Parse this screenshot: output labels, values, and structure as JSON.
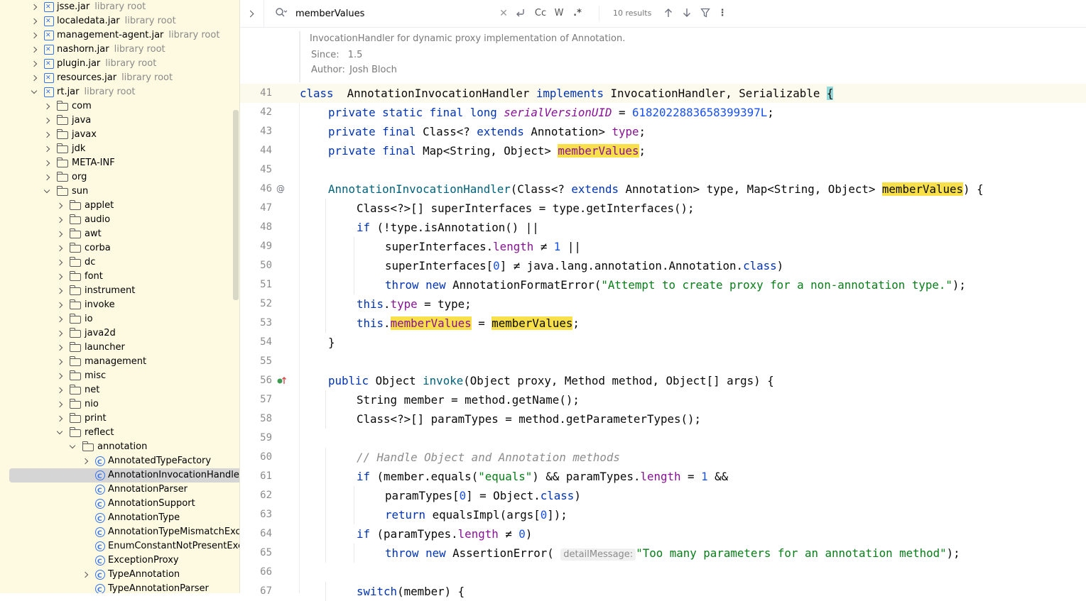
{
  "tree": {
    "rows": [
      {
        "indent": 0,
        "chev": "closed",
        "icon": "jar",
        "label": "jsse.jar",
        "sub": "library root"
      },
      {
        "indent": 0,
        "chev": "closed",
        "icon": "jar",
        "label": "localedata.jar",
        "sub": "library root"
      },
      {
        "indent": 0,
        "chev": "closed",
        "icon": "jar",
        "label": "management-agent.jar",
        "sub": "library root"
      },
      {
        "indent": 0,
        "chev": "closed",
        "icon": "jar",
        "label": "nashorn.jar",
        "sub": "library root"
      },
      {
        "indent": 0,
        "chev": "closed",
        "icon": "jar",
        "label": "plugin.jar",
        "sub": "library root"
      },
      {
        "indent": 0,
        "chev": "closed",
        "icon": "jar",
        "label": "resources.jar",
        "sub": "library root"
      },
      {
        "indent": 0,
        "chev": "open",
        "icon": "jar",
        "label": "rt.jar",
        "sub": "library root"
      },
      {
        "indent": 1,
        "chev": "closed",
        "icon": "folder",
        "label": "com",
        "sub": ""
      },
      {
        "indent": 1,
        "chev": "closed",
        "icon": "folder",
        "label": "java",
        "sub": ""
      },
      {
        "indent": 1,
        "chev": "closed",
        "icon": "folder",
        "label": "javax",
        "sub": ""
      },
      {
        "indent": 1,
        "chev": "closed",
        "icon": "folder",
        "label": "jdk",
        "sub": ""
      },
      {
        "indent": 1,
        "chev": "closed",
        "icon": "folder",
        "label": "META-INF",
        "sub": ""
      },
      {
        "indent": 1,
        "chev": "closed",
        "icon": "folder",
        "label": "org",
        "sub": ""
      },
      {
        "indent": 1,
        "chev": "open",
        "icon": "folder",
        "label": "sun",
        "sub": ""
      },
      {
        "indent": 2,
        "chev": "closed",
        "icon": "folder",
        "label": "applet",
        "sub": ""
      },
      {
        "indent": 2,
        "chev": "closed",
        "icon": "folder",
        "label": "audio",
        "sub": ""
      },
      {
        "indent": 2,
        "chev": "closed",
        "icon": "folder",
        "label": "awt",
        "sub": ""
      },
      {
        "indent": 2,
        "chev": "closed",
        "icon": "folder",
        "label": "corba",
        "sub": ""
      },
      {
        "indent": 2,
        "chev": "closed",
        "icon": "folder",
        "label": "dc",
        "sub": ""
      },
      {
        "indent": 2,
        "chev": "closed",
        "icon": "folder",
        "label": "font",
        "sub": ""
      },
      {
        "indent": 2,
        "chev": "closed",
        "icon": "folder",
        "label": "instrument",
        "sub": ""
      },
      {
        "indent": 2,
        "chev": "closed",
        "icon": "folder",
        "label": "invoke",
        "sub": ""
      },
      {
        "indent": 2,
        "chev": "closed",
        "icon": "folder",
        "label": "io",
        "sub": ""
      },
      {
        "indent": 2,
        "chev": "closed",
        "icon": "folder",
        "label": "java2d",
        "sub": ""
      },
      {
        "indent": 2,
        "chev": "closed",
        "icon": "folder",
        "label": "launcher",
        "sub": ""
      },
      {
        "indent": 2,
        "chev": "closed",
        "icon": "folder",
        "label": "management",
        "sub": ""
      },
      {
        "indent": 2,
        "chev": "closed",
        "icon": "folder",
        "label": "misc",
        "sub": ""
      },
      {
        "indent": 2,
        "chev": "closed",
        "icon": "folder",
        "label": "net",
        "sub": ""
      },
      {
        "indent": 2,
        "chev": "closed",
        "icon": "folder",
        "label": "nio",
        "sub": ""
      },
      {
        "indent": 2,
        "chev": "closed",
        "icon": "folder",
        "label": "print",
        "sub": ""
      },
      {
        "indent": 2,
        "chev": "open",
        "icon": "folder",
        "label": "reflect",
        "sub": ""
      },
      {
        "indent": 3,
        "chev": "open",
        "icon": "folder",
        "label": "annotation",
        "sub": ""
      },
      {
        "indent": 4,
        "chev": "closed",
        "icon": "cls",
        "label": "AnnotatedTypeFactory",
        "sub": ""
      },
      {
        "indent": 4,
        "chev": "none",
        "icon": "cls",
        "label": "AnnotationInvocationHandler",
        "sub": "",
        "selected": true
      },
      {
        "indent": 4,
        "chev": "none",
        "icon": "cls",
        "label": "AnnotationParser",
        "sub": ""
      },
      {
        "indent": 4,
        "chev": "none",
        "icon": "cls",
        "label": "AnnotationSupport",
        "sub": ""
      },
      {
        "indent": 4,
        "chev": "none",
        "icon": "cls",
        "label": "AnnotationType",
        "sub": ""
      },
      {
        "indent": 4,
        "chev": "none",
        "icon": "cls",
        "label": "AnnotationTypeMismatchExce",
        "sub": ""
      },
      {
        "indent": 4,
        "chev": "none",
        "icon": "cls",
        "label": "EnumConstantNotPresentExc",
        "sub": ""
      },
      {
        "indent": 4,
        "chev": "none",
        "icon": "cls",
        "label": "ExceptionProxy",
        "sub": ""
      },
      {
        "indent": 4,
        "chev": "closed",
        "icon": "cls",
        "label": "TypeAnnotation",
        "sub": ""
      },
      {
        "indent": 4,
        "chev": "none",
        "icon": "cls",
        "label": "TypeAnnotationParser",
        "sub": ""
      }
    ]
  },
  "find": {
    "value": "memberValues",
    "results": "10 results",
    "match_case": "Cc",
    "words": "W",
    "regex": ".*"
  },
  "doc": {
    "description": "InvocationHandler for dynamic proxy implementation of Annotation.",
    "since_label": "Since:",
    "since_value": "1.5",
    "author_label": "Author:",
    "author_value": "Josh Bloch"
  },
  "code": {
    "lines": [
      {
        "n": "41",
        "cur": true,
        "ind": 0,
        "segs": [
          [
            "kw",
            "class"
          ],
          [
            "",
            "  AnnotationInvocationHandler "
          ],
          [
            "kw",
            "implements"
          ],
          [
            "",
            " InvocationHandler, Serializable "
          ],
          [
            "brace",
            "{"
          ]
        ]
      },
      {
        "n": "42",
        "ind": 1,
        "segs": [
          [
            "kw",
            "private static final long "
          ],
          [
            "sfld",
            "serialVersionUID"
          ],
          [
            "",
            " = "
          ],
          [
            "num",
            "6182022883658399397L"
          ],
          [
            "",
            ";"
          ]
        ]
      },
      {
        "n": "43",
        "ind": 1,
        "segs": [
          [
            "kw",
            "private final "
          ],
          [
            "",
            "Class<? "
          ],
          [
            "kw",
            "extends"
          ],
          [
            "",
            " Annotation> "
          ],
          [
            "fld",
            "type"
          ],
          [
            "",
            ";"
          ]
        ]
      },
      {
        "n": "44",
        "ind": 1,
        "segs": [
          [
            "kw",
            "private final "
          ],
          [
            "",
            "Map<String, Object> "
          ],
          [
            "fldhl",
            "memberValues"
          ],
          [
            "",
            ";"
          ]
        ]
      },
      {
        "n": "45",
        "ind": 0,
        "segs": []
      },
      {
        "n": "46",
        "ind": 1,
        "gicon": "@",
        "segs": [
          [
            "fn",
            "AnnotationInvocationHandler"
          ],
          [
            "",
            "(Class<? "
          ],
          [
            "kw",
            "extends"
          ],
          [
            "",
            " Annotation> type, Map<String, Object> "
          ],
          [
            "hl",
            "memberValues"
          ],
          [
            "",
            ") {"
          ]
        ]
      },
      {
        "n": "47",
        "ind": 2,
        "segs": [
          [
            "",
            "Class<?>[] superInterfaces = type.getInterfaces();"
          ]
        ]
      },
      {
        "n": "48",
        "ind": 2,
        "segs": [
          [
            "kw",
            "if"
          ],
          [
            "",
            " (!type.isAnnotation() ||"
          ]
        ]
      },
      {
        "n": "49",
        "ind": 3,
        "segs": [
          [
            "",
            "superInterfaces."
          ],
          [
            "fld",
            "length"
          ],
          [
            "",
            " ≠ "
          ],
          [
            "num",
            "1"
          ],
          [
            "",
            " ||"
          ]
        ]
      },
      {
        "n": "50",
        "ind": 3,
        "segs": [
          [
            "",
            "superInterfaces["
          ],
          [
            "num",
            "0"
          ],
          [
            "",
            "] ≠ java.lang.annotation.Annotation."
          ],
          [
            "kw",
            "class"
          ],
          [
            "",
            ")"
          ]
        ]
      },
      {
        "n": "51",
        "ind": 3,
        "segs": [
          [
            "kw",
            "throw new "
          ],
          [
            "",
            "AnnotationFormatError("
          ],
          [
            "str",
            "\"Attempt to create proxy for a non-annotation type.\""
          ],
          [
            "",
            ");"
          ]
        ]
      },
      {
        "n": "52",
        "ind": 2,
        "segs": [
          [
            "kw",
            "this"
          ],
          [
            "",
            "."
          ],
          [
            "fld",
            "type"
          ],
          [
            "",
            " = type;"
          ]
        ]
      },
      {
        "n": "53",
        "ind": 2,
        "segs": [
          [
            "kw",
            "this"
          ],
          [
            "",
            "."
          ],
          [
            "fldhl",
            "memberValues"
          ],
          [
            "",
            " = "
          ],
          [
            "hl",
            "memberValues"
          ],
          [
            "",
            ";"
          ]
        ]
      },
      {
        "n": "54",
        "ind": 1,
        "segs": [
          [
            "",
            "}"
          ]
        ]
      },
      {
        "n": "55",
        "ind": 0,
        "segs": []
      },
      {
        "n": "56",
        "ind": 1,
        "gicon": "impl",
        "segs": [
          [
            "kw",
            "public "
          ],
          [
            "",
            "Object "
          ],
          [
            "fn",
            "invoke"
          ],
          [
            "",
            "(Object proxy, Method method, Object[] args) {"
          ]
        ]
      },
      {
        "n": "57",
        "ind": 2,
        "segs": [
          [
            "",
            "String member = method.getName();"
          ]
        ]
      },
      {
        "n": "58",
        "ind": 2,
        "segs": [
          [
            "",
            "Class<?>[] paramTypes = method.getParameterTypes();"
          ]
        ]
      },
      {
        "n": "59",
        "ind": 0,
        "segs": []
      },
      {
        "n": "60",
        "ind": 2,
        "segs": [
          [
            "cmt",
            "// Handle Object and Annotation methods"
          ]
        ]
      },
      {
        "n": "61",
        "ind": 2,
        "segs": [
          [
            "kw",
            "if"
          ],
          [
            "",
            " (member.equals("
          ],
          [
            "str",
            "\"equals\""
          ],
          [
            "",
            ") && paramTypes."
          ],
          [
            "fld",
            "length"
          ],
          [
            "",
            " = "
          ],
          [
            "num",
            "1"
          ],
          [
            "",
            " &&"
          ]
        ]
      },
      {
        "n": "62",
        "ind": 3,
        "segs": [
          [
            "",
            "paramTypes["
          ],
          [
            "num",
            "0"
          ],
          [
            "",
            "] = Object."
          ],
          [
            "kw",
            "class"
          ],
          [
            "",
            ")"
          ]
        ]
      },
      {
        "n": "63",
        "ind": 3,
        "segs": [
          [
            "kw",
            "return "
          ],
          [
            "",
            "equalsImpl(args["
          ],
          [
            "num",
            "0"
          ],
          [
            "",
            "]);"
          ]
        ]
      },
      {
        "n": "64",
        "ind": 2,
        "segs": [
          [
            "kw",
            "if"
          ],
          [
            "",
            " (paramTypes."
          ],
          [
            "fld",
            "length"
          ],
          [
            "",
            " ≠ "
          ],
          [
            "num",
            "0"
          ],
          [
            "",
            ")"
          ]
        ]
      },
      {
        "n": "65",
        "ind": 3,
        "segs": [
          [
            "kw",
            "throw new "
          ],
          [
            "",
            "AssertionError( "
          ],
          [
            "hint",
            "detailMessage:"
          ],
          [
            "str",
            "\"Too many parameters for an annotation method\""
          ],
          [
            "",
            ");"
          ]
        ]
      },
      {
        "n": "66",
        "ind": 0,
        "segs": []
      },
      {
        "n": "67",
        "ind": 2,
        "segs": [
          [
            "kw",
            "switch"
          ],
          [
            "",
            "(member) {"
          ]
        ]
      }
    ]
  }
}
